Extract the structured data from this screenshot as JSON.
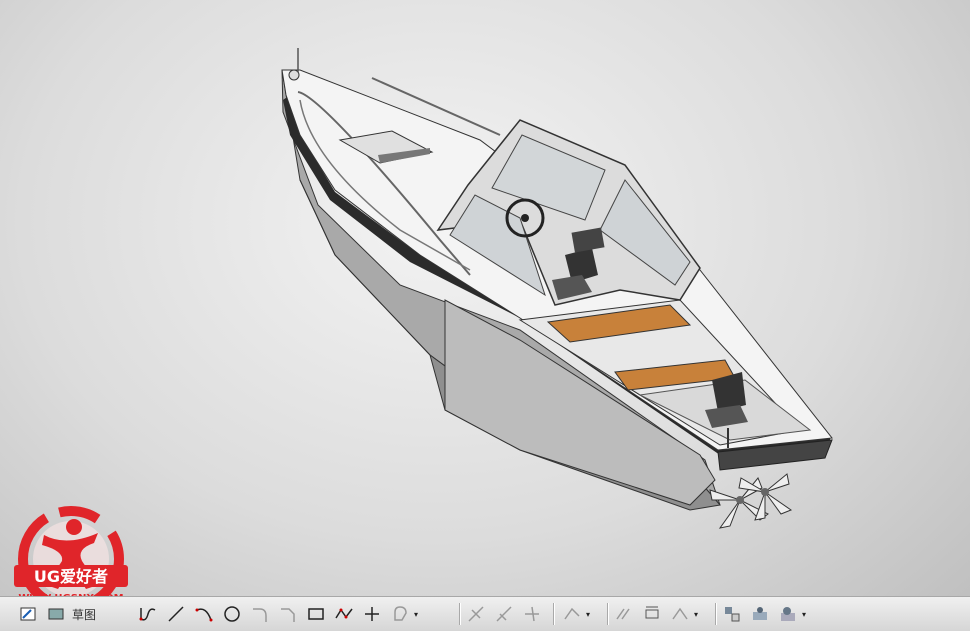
{
  "watermark": {
    "brand": "UG爱好者",
    "url": "WWW.UGSNX.COM",
    "primary_color": "#e0252a"
  },
  "viewport": {
    "model": "boat",
    "background_colors": [
      "#f3f3f3",
      "#bdbdbd"
    ],
    "hull_color": "#9a9a9a",
    "deck_color": "#f2f2f2",
    "trim_color": "#2b2b2b",
    "cushion_color": "#c8813a"
  },
  "toolbar": {
    "sketch_label": "草图",
    "buttons": [
      "sketch-icon",
      "finish-sketch-icon",
      "profile-icon",
      "line-icon",
      "arc-icon",
      "circle-icon",
      "fillet-icon",
      "chamfer-icon",
      "rectangle-icon",
      "polygon-icon",
      "point-icon",
      "studio-spline-icon",
      "quick-trim-icon",
      "quick-extend-icon",
      "make-corner-icon",
      "offset-curve-icon",
      "mirror-curve-icon",
      "pattern-curve-icon",
      "constraint-icon",
      "dimension-icon",
      "show-constraints-icon",
      "display-sketch-icon",
      "sketch-settings-icon"
    ]
  }
}
